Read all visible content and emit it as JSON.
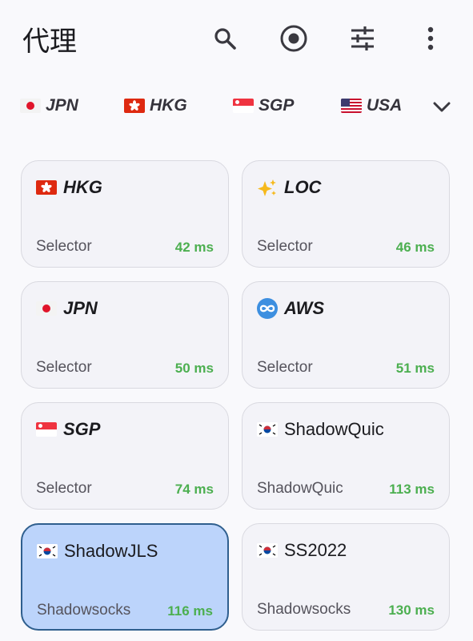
{
  "app": {
    "title": "代理"
  },
  "toolbar": {
    "icons": [
      "search-icon",
      "record-icon",
      "tune-icon",
      "more-vert-icon"
    ]
  },
  "tabs": [
    {
      "label": "JPN",
      "flag": "jp"
    },
    {
      "label": "HKG",
      "flag": "hk"
    },
    {
      "label": "SGP",
      "flag": "sg"
    },
    {
      "label": "USA",
      "flag": "us"
    }
  ],
  "proxies": [
    {
      "name": "HKG",
      "type": "Selector",
      "latency": "42 ms",
      "icon": "hk-flag"
    },
    {
      "name": "LOC",
      "type": "Selector",
      "latency": "46 ms",
      "icon": "sparkles-icon"
    },
    {
      "name": "JPN",
      "type": "Selector",
      "latency": "50 ms",
      "icon": "jp-flag"
    },
    {
      "name": "AWS",
      "type": "Selector",
      "latency": "51 ms",
      "icon": "infinity-icon"
    },
    {
      "name": "SGP",
      "type": "Selector",
      "latency": "74 ms",
      "icon": "sg-flag"
    },
    {
      "name": "ShadowQuic",
      "type": "ShadowQuic",
      "latency": "113 ms",
      "icon": "kr-flag"
    },
    {
      "name": "ShadowJLS",
      "type": "Shadowsocks",
      "latency": "116 ms",
      "icon": "kr-flag",
      "selected": true
    },
    {
      "name": "SS2022",
      "type": "Shadowsocks",
      "latency": "130 ms",
      "icon": "kr-flag"
    }
  ],
  "colors": {
    "latency": "#4caf50",
    "selected_bg": "#bcd4fb",
    "selected_border": "#2f5f8e"
  }
}
